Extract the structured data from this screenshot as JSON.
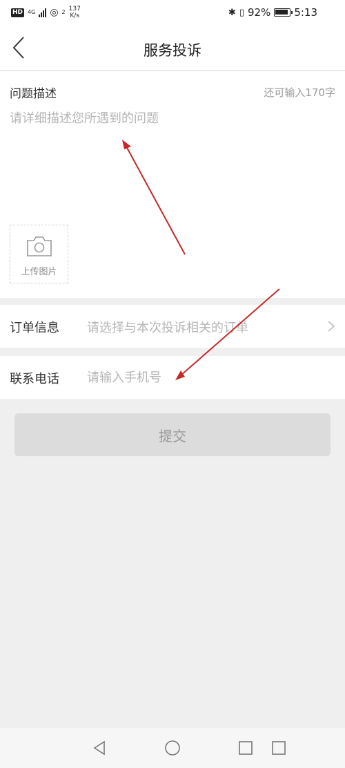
{
  "status_bar": {
    "left_badge": "HD",
    "network": "4G",
    "wifi_level": "2",
    "speed_value": "137",
    "speed_unit": "K/s",
    "battery": "92%",
    "time": "5:13"
  },
  "header": {
    "title": "服务投诉"
  },
  "description": {
    "label": "问题描述",
    "counter": "还可输入170字",
    "placeholder": "请详细描述您所遇到的问题",
    "upload_label": "上传图片"
  },
  "order": {
    "label": "订单信息",
    "placeholder": "请选择与本次投诉相关的订单"
  },
  "phone": {
    "label": "联系电话",
    "placeholder": "请输入手机号"
  },
  "submit": {
    "label": "提交"
  },
  "colors": {
    "annotation_arrow": "#c62828",
    "submit_bg": "#dcdcdc",
    "page_bg": "#efefef"
  },
  "icons": [
    "back-icon",
    "camera-icon",
    "chevron-right-icon",
    "nav-back-icon",
    "nav-home-icon",
    "nav-recents-icon"
  ]
}
